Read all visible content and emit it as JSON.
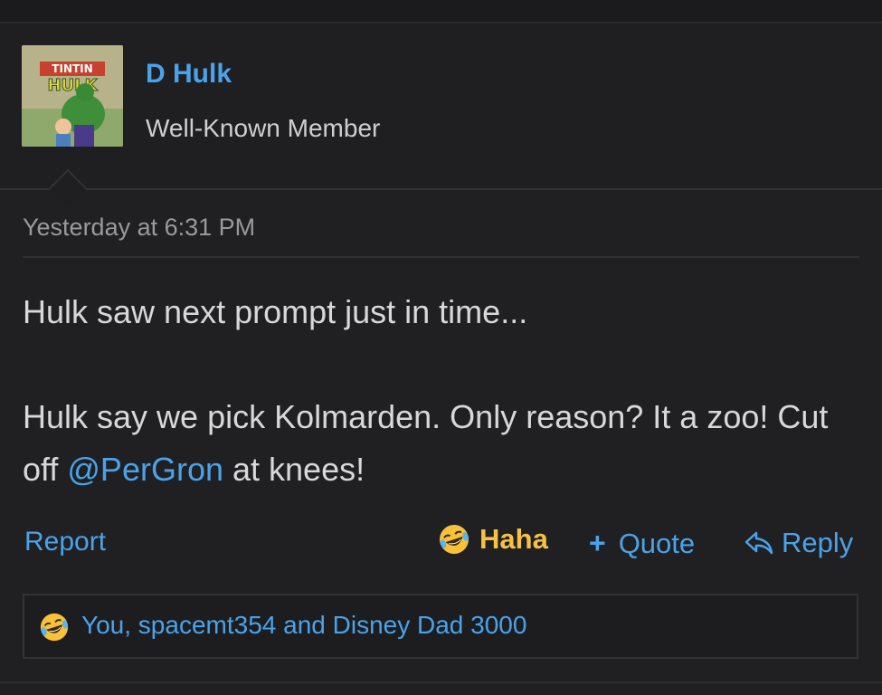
{
  "post": {
    "author": {
      "name": "D Hulk",
      "title": "Well-Known Member",
      "avatar": {
        "text_top": "TINTIN",
        "text_main": "HULK"
      }
    },
    "timestamp": "Yesterday at 6:31 PM",
    "message": {
      "line1": "Hulk saw next prompt just in time...",
      "line2_prefix": "Hulk say we pick Kolmarden. Only reason? It a zoo! Cut off ",
      "mention": "@PerGron",
      "line2_suffix": " at knees!"
    },
    "actions": {
      "report": "Report",
      "reaction": "Haha",
      "quote": "Quote",
      "reply": "Reply"
    },
    "reactions_summary": "You, spacemt354 and Disney Dad 3000"
  },
  "colors": {
    "background": "#202022",
    "link": "#4aa3ea",
    "haha": "#f5c244",
    "text": "#d8d8d8"
  },
  "icons": {
    "reaction": "laughing-crying-emoji",
    "quote": "plus-icon",
    "reply": "reply-arrow-icon"
  }
}
